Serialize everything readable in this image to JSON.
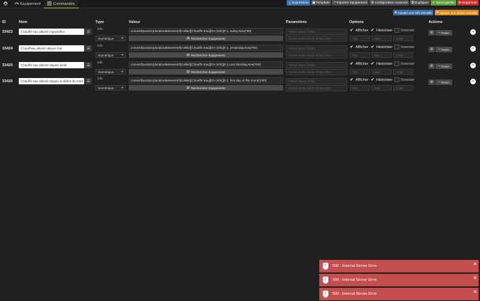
{
  "tabs": [
    {
      "label": "",
      "icon": "home-icon"
    },
    {
      "label": "Équipement",
      "icon": "tachometer-icon"
    },
    {
      "label": "Commandes",
      "icon": "list-icon"
    }
  ],
  "topbar_buttons": [
    {
      "label": "Expression",
      "color": "#3a6ea5",
      "icon": "info-icon"
    },
    {
      "label": "Template",
      "color": "#4a4a4a",
      "icon": "cube-icon"
    },
    {
      "label": "Importer équipement",
      "color": "#4a4a4a",
      "icon": "share-icon"
    },
    {
      "label": "Configuration avancée",
      "color": "#4a4a4a",
      "icon": "gear-icon"
    },
    {
      "label": "Dupliquer",
      "color": "#4a4a4a",
      "icon": "copy-icon"
    },
    {
      "label": "Sauvegarder",
      "color": "#5a9e3a",
      "icon": "check-icon"
    },
    {
      "label": "Supprimer",
      "color": "#c9302c",
      "icon": "minus-icon"
    }
  ],
  "add_buttons": [
    {
      "label": "Ajouter une info virtuelle",
      "color": "#3a6ea5",
      "icon": "plus-icon"
    },
    {
      "label": "Ajouter une action virtuelle",
      "color": "#e08a1e",
      "icon": "plus-icon"
    }
  ],
  "columns": {
    "id": "ID",
    "nom": "Nom",
    "type": "Type",
    "valeur": "Valeur",
    "parametres": "Paramètres",
    "options": "Options",
    "actions": "Actions"
  },
  "rows": [
    {
      "id": "33423",
      "name": "Chauffe eau allumé Aujourdhui",
      "type": "info",
      "subtype": "Numérique",
      "value": "convertDuration(durationBetween(#[Cellier][Chauffe Eau][On (Info)]#,1, today,Now)*60)",
      "search_label": "Rechercher équipement",
      "param1": "Valeur retour d'état",
      "param2": "Durée avant retour d'état (min)",
      "afficher": "Afficher",
      "afficher_checked": true,
      "historiser": "Historiser",
      "historiser_checked": true,
      "inverser": "Inverser",
      "inverser_checked": false,
      "min": "Min",
      "max": "Max",
      "unite": "Unité",
      "test_label": "Tester"
    },
    {
      "id": "33424",
      "name": "Chauffeau  allumé depuis hier",
      "type": "info",
      "subtype": "Numérique",
      "value": "convertDuration(durationBetween(#[Cellier][Chauffe Eau][On (Info)]#,1, yesterday,Now)*60)",
      "search_label": "Rechercher équipement",
      "param1": "Valeur retour d'état",
      "param2": "Durée avant retour d'état (min)",
      "afficher": "Afficher",
      "afficher_checked": true,
      "historiser": "Historiser",
      "historiser_checked": true,
      "inverser": "Inverser",
      "inverser_checked": false,
      "min": "Min",
      "max": "Max",
      "unite": "Unité",
      "test_label": "Tester"
    },
    {
      "id": "33425",
      "name": "Chauffe eau allumé depuis lundi",
      "type": "info",
      "subtype": "Numérique",
      "value": "convertDuration(durationBetween(#[Cellier][Chauffe Eau][On (Info)]#,1,Last Monday,Now)*60)",
      "search_label": "Rechercher équipement",
      "param1": "Valeur retour d'état",
      "param2": "Durée avant retour d'état (min)",
      "afficher": "Afficher",
      "afficher_checked": true,
      "historiser": "Historiser",
      "historiser_checked": true,
      "inverser": "Inverser",
      "inverser_checked": false,
      "min": "Min",
      "max": "Max",
      "unite": "Unité",
      "test_label": "Tester"
    },
    {
      "id": "33426",
      "name": "Chauffe eau allumé depuis le début du mois",
      "type": "info",
      "subtype": "Numérique",
      "value": "convertDuration(durationBetween(#[Cellier][Chauffe Eau][On (Info)]#,1, first day of this month)*60)",
      "search_label": "Rechercher équipement",
      "param1": "Valeur retour d'état",
      "param2": "Durée avant retour d'état (min)",
      "afficher": "Afficher",
      "afficher_checked": true,
      "historiser": "Historiser",
      "historiser_checked": true,
      "inverser": "Inverser",
      "inverser_checked": false,
      "min": "Min",
      "max": "Max",
      "unite": "Unité",
      "test_label": "Tester"
    }
  ],
  "toasts": [
    {
      "text": "500 : Internal Server Error",
      "color": "#c44d4d"
    },
    {
      "text": "500 : Internal Server Error",
      "color": "#c44d4d"
    },
    {
      "text": "500 : Internal Server Error",
      "color": "#c44d4d"
    }
  ]
}
